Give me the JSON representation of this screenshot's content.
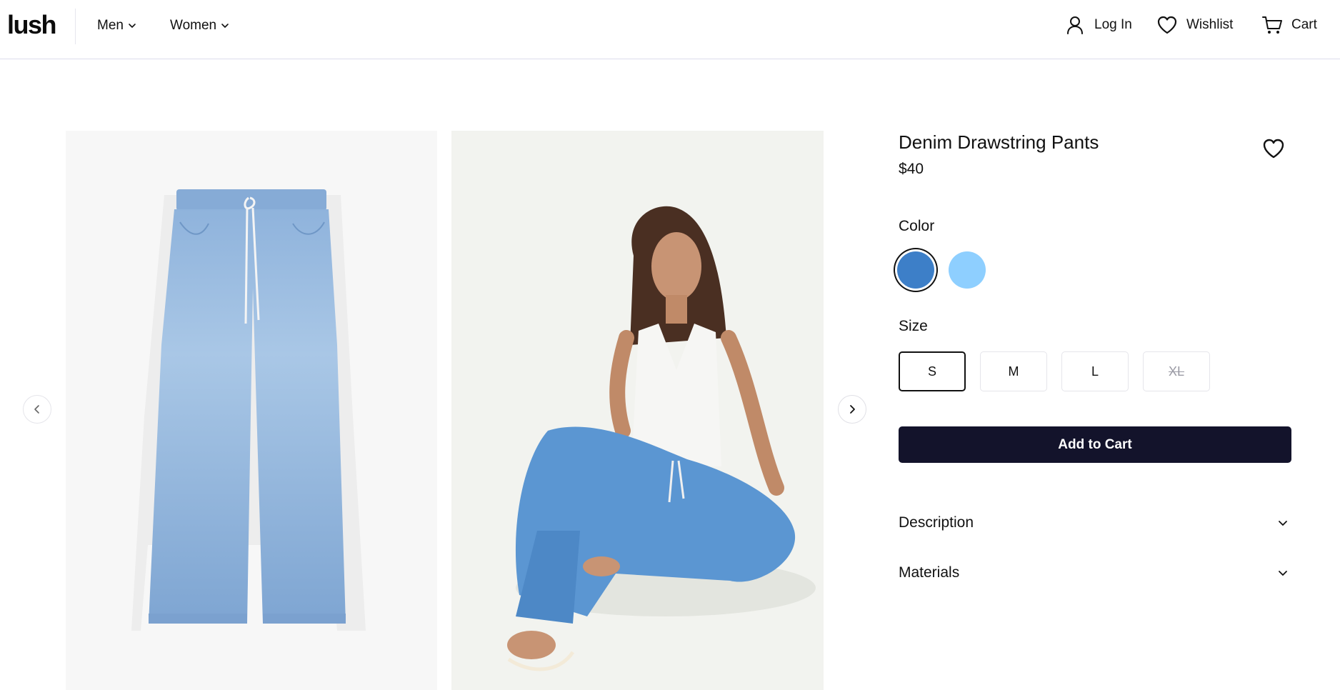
{
  "header": {
    "logo": "lush",
    "nav": [
      {
        "label": "Men"
      },
      {
        "label": "Women"
      }
    ],
    "actions": {
      "login": "Log In",
      "wishlist": "Wishlist",
      "cart": "Cart"
    },
    "icons": {
      "login": "user-icon",
      "wishlist": "heart-icon",
      "cart": "cart-icon",
      "dropdown": "chevron-down-icon"
    }
  },
  "gallery": {
    "images": [
      {
        "name": "pants-product-image",
        "background": "#f7f7f7"
      },
      {
        "name": "model-wearing-pants-image",
        "background": "#f2f3ef"
      }
    ],
    "prev_icon": "chevron-left-icon",
    "next_icon": "chevron-right-icon"
  },
  "product": {
    "title": "Denim Drawstring Pants",
    "price": "$40",
    "wishlist_icon": "heart-outline-icon",
    "color_label": "Color",
    "colors": [
      {
        "hex": "#3d7fc8",
        "selected": true
      },
      {
        "hex": "#8ecfff",
        "selected": false
      }
    ],
    "size_label": "Size",
    "sizes": [
      {
        "label": "S",
        "selected": true,
        "available": true
      },
      {
        "label": "M",
        "selected": false,
        "available": true
      },
      {
        "label": "L",
        "selected": false,
        "available": true
      },
      {
        "label": "XL",
        "selected": false,
        "available": false
      }
    ],
    "add_to_cart": "Add to Cart",
    "accordions": [
      {
        "label": "Description",
        "expanded": false
      },
      {
        "label": "Materials",
        "expanded": false
      }
    ]
  },
  "colors": {
    "primary_button": "#13132b",
    "header_border": "#dcdcec"
  }
}
